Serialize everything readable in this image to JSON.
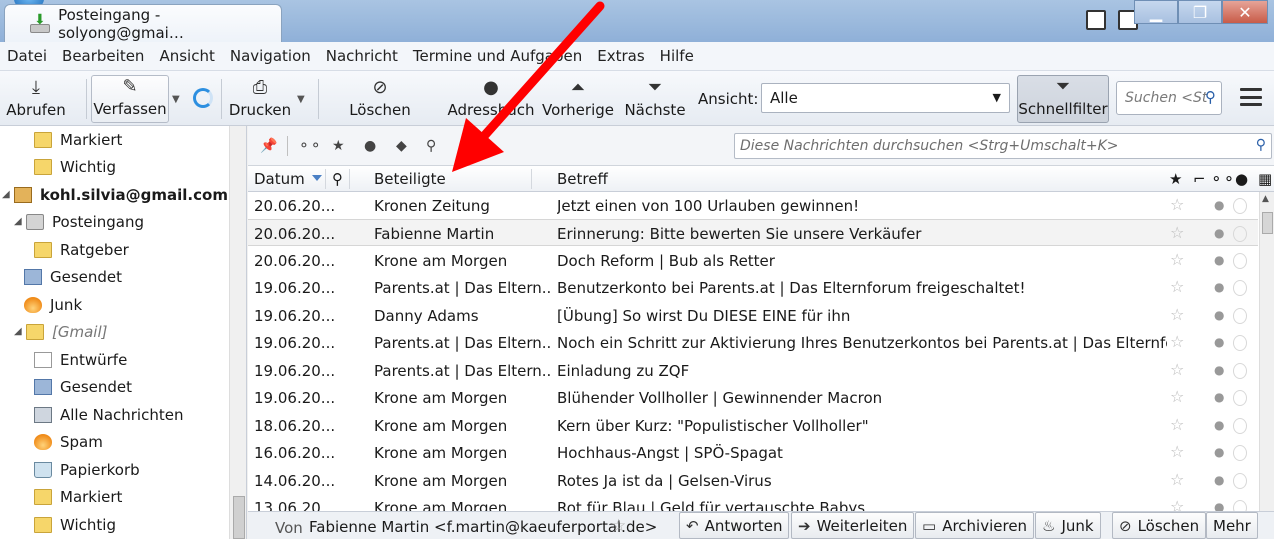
{
  "window": {
    "tab_title": "Posteingang - solyong@gmai…"
  },
  "menu": [
    "Datei",
    "Bearbeiten",
    "Ansicht",
    "Navigation",
    "Nachricht",
    "Termine und Aufgaben",
    "Extras",
    "Hilfe"
  ],
  "toolbar": {
    "get_label": "Abrufen",
    "compose_label": "Verfassen",
    "print_label": "Drucken",
    "delete_label": "Löschen",
    "addressbook_label": "Adressbuch",
    "prev_label": "Vorherige",
    "next_label": "Nächste",
    "view_label": "Ansicht:",
    "view_value": "Alle",
    "quickfilter_label": "Schnellfilter",
    "search_placeholder": "Suchen <St"
  },
  "folders": {
    "starred_1": "Markiert",
    "important_1": "Wichtig",
    "account": "kohl.silvia@gmail.com",
    "inbox": "Posteingang",
    "advisor": "Ratgeber",
    "sent_1": "Gesendet",
    "junk": "Junk",
    "gmail": "[Gmail]",
    "drafts": "Entwürfe",
    "sent_2": "Gesendet",
    "all_mail": "Alle Nachrichten",
    "spam": "Spam",
    "trash": "Papierkorb",
    "starred_2": "Markiert",
    "important_2": "Wichtig"
  },
  "quickfilter": {
    "search_placeholder": "Diese Nachrichten durchsuchen <Strg+Umschalt+K>"
  },
  "columns": {
    "date": "Datum",
    "participants": "Beteiligte",
    "subject": "Betreff"
  },
  "messages": [
    {
      "date": "20.06.20...",
      "from": "Kronen Zeitung",
      "subject": "Jetzt einen von 100 Urlauben gewinnen!"
    },
    {
      "date": "20.06.20...",
      "from": "Fabienne Martin",
      "subject": "Erinnerung: Bitte bewerten Sie unsere Verkäufer"
    },
    {
      "date": "20.06.20...",
      "from": "Krone am Morgen",
      "subject": "Doch Reform | Bub als Retter"
    },
    {
      "date": "19.06.20...",
      "from": "Parents.at | Das Eltern...",
      "subject": "Benutzerkonto bei Parents.at | Das Elternforum freigeschaltet!"
    },
    {
      "date": "19.06.20...",
      "from": "Danny Adams",
      "subject": "[Übung] So wirst Du DIESE EINE für ihn"
    },
    {
      "date": "19.06.20...",
      "from": "Parents.at | Das Eltern...",
      "subject": "Noch ein Schritt zur Aktivierung Ihres Benutzerkontos bei Parents.at | Das Elternforum noetig"
    },
    {
      "date": "19.06.20...",
      "from": "Parents.at | Das Eltern...",
      "subject": "Einladung zu ZQF"
    },
    {
      "date": "19.06.20...",
      "from": "Krone am Morgen",
      "subject": "Blühender Vollholler | Gewinnender Macron"
    },
    {
      "date": "18.06.20...",
      "from": "Krone am Morgen",
      "subject": "Kern über Kurz: \"Populistischer Vollholler\""
    },
    {
      "date": "16.06.20...",
      "from": "Krone am Morgen",
      "subject": "Hochhaus-Angst | SPÖ-Spagat"
    },
    {
      "date": "14.06.20...",
      "from": "Krone am Morgen",
      "subject": "Rotes Ja ist da | Gelsen-Virus"
    },
    {
      "date": "13.06.20...",
      "from": "Krone am Morgen",
      "subject": "Rot für Blau | Geld für vertauschte Babys"
    }
  ],
  "message_header": {
    "from_label": "Von",
    "from_value": "Fabienne Martin <f.martin@kaeuferportal.de>",
    "reply": "Antworten",
    "forward": "Weiterleiten",
    "archive": "Archivieren",
    "junk": "Junk",
    "delete": "Löschen",
    "more": "Mehr"
  },
  "colors": {
    "annotation_arrow": "#ff0000",
    "sort_indicator": "#4a7fc4"
  }
}
